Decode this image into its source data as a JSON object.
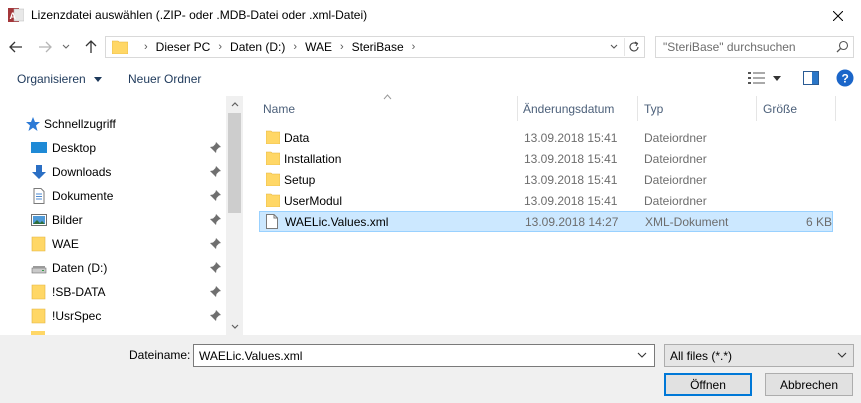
{
  "window": {
    "title": "Lizenzdatei auswählen (.ZIP- oder .MDB-Datei oder .xml-Datei)",
    "app_icon": "access-app-icon",
    "close_icon": "close-icon"
  },
  "navigation": {
    "breadcrumbs": [
      "Dieser PC",
      "Daten (D:)",
      "WAE",
      "SteriBase"
    ],
    "search_placeholder": "\"SteriBase\" durchsuchen"
  },
  "toolbar": {
    "organize_label": "Organisieren",
    "new_folder_label": "Neuer Ordner"
  },
  "nav_pane": {
    "items": [
      {
        "label": "Schnellzugriff",
        "icon": "star-icon"
      },
      {
        "label": "Desktop",
        "icon": "desktop-icon"
      },
      {
        "label": "Downloads",
        "icon": "download-icon"
      },
      {
        "label": "Dokumente",
        "icon": "documents-icon"
      },
      {
        "label": "Bilder",
        "icon": "pictures-icon"
      },
      {
        "label": "WAE",
        "icon": "folder-icon"
      },
      {
        "label": "Daten (D:)",
        "icon": "drive-icon"
      },
      {
        "label": "!SB-DATA",
        "icon": "folder-icon"
      },
      {
        "label": "!UsrSpec",
        "icon": "folder-icon"
      }
    ]
  },
  "file_list": {
    "columns": [
      "Name",
      "Änderungsdatum",
      "Typ",
      "Größe"
    ],
    "rows": [
      {
        "name": "Data",
        "date": "13.09.2018 15:41",
        "type": "Dateiordner",
        "size": "",
        "icon": "folder-icon"
      },
      {
        "name": "Installation",
        "date": "13.09.2018 15:41",
        "type": "Dateiordner",
        "size": "",
        "icon": "folder-icon"
      },
      {
        "name": "Setup",
        "date": "13.09.2018 15:41",
        "type": "Dateiordner",
        "size": "",
        "icon": "folder-icon"
      },
      {
        "name": "UserModul",
        "date": "13.09.2018 15:41",
        "type": "Dateiordner",
        "size": "",
        "icon": "folder-icon"
      },
      {
        "name": "WAELic.Values.xml",
        "date": "13.09.2018 14:27",
        "type": "XML-Dokument",
        "size": "6 KB",
        "icon": "file-icon",
        "selected": true
      }
    ]
  },
  "footer": {
    "filename_label": "Dateiname:",
    "filename_value": "WAELic.Values.xml",
    "filter_value": "All files (*.*)",
    "open_label": "Öffnen",
    "cancel_label": "Abbrechen"
  },
  "colors": {
    "selection": "#cce8ff",
    "folder": "#ffd766",
    "accent": "#0078d7"
  }
}
